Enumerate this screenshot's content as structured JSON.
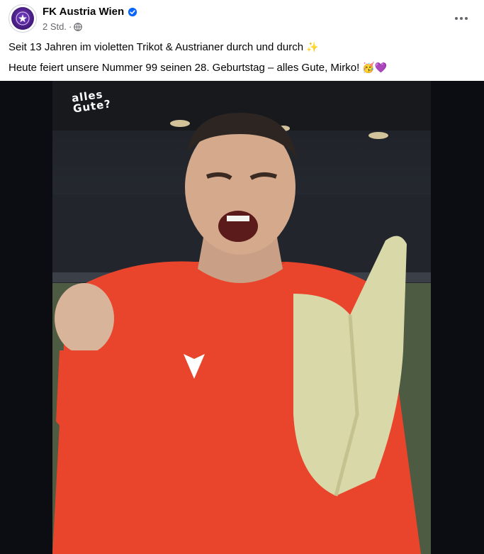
{
  "post": {
    "page_name": "FK Austria Wien",
    "timestamp": "2 Std.",
    "separator": "·",
    "caption_lines": [
      {
        "text": "Seit 13 Jahren im violetten Trikot & Austrianer durch und durch",
        "emoji": "✨"
      },
      {
        "text": "Heute feiert unsere Nummer 99 seinen 28. Geburtstag – alles Gute, Mirko!",
        "emoji": "🥳💜"
      }
    ],
    "image": {
      "overlay_text_line1": "alles",
      "overlay_text_line2": "Gute?"
    }
  },
  "icons": {
    "verified": "verified-badge-icon",
    "privacy": "globe-icon",
    "more": "more-options-icon"
  },
  "colors": {
    "verified_blue": "#0866ff",
    "jersey_red": "#e8452c",
    "club_violet": "#4b1f86",
    "meta_gray": "#65676b"
  }
}
